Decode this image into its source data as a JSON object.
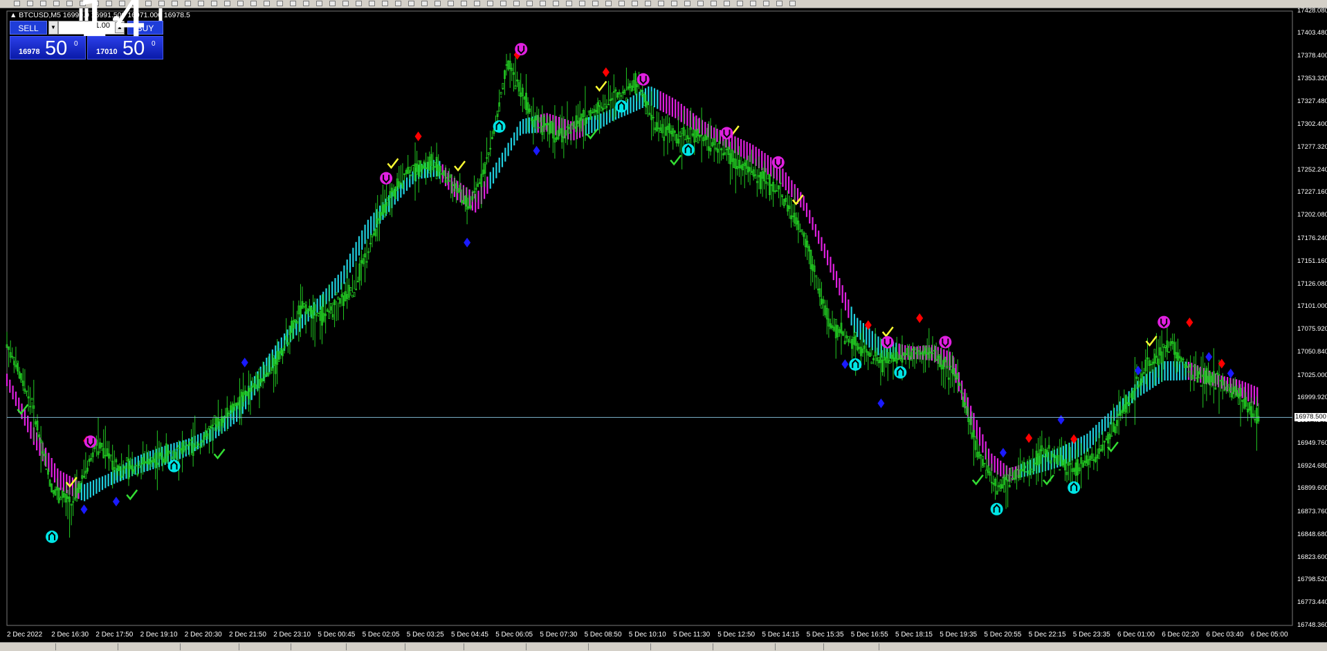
{
  "window": {
    "symbol_title": "▲ BTCUSD,M5  16990.0  16991.500  16971.000  16978.5",
    "overlay_digits": "14"
  },
  "trade_panel": {
    "sell_label": "SELL",
    "buy_label": "BUY",
    "lot_value": "1.00",
    "sell_price_small": "16978",
    "sell_price_big": "50",
    "sell_price_sup": "0",
    "buy_price_small": "17010",
    "buy_price_big": "50",
    "buy_price_sup": "0"
  },
  "current_price": "16978.500",
  "colors": {
    "candle": "#22cc22",
    "band_up": "#20d0e0",
    "band_down": "#e020e0",
    "buy_arrow": "#00e5e5",
    "sell_arrow": "#e020e0",
    "diamond_red": "#ff0000",
    "diamond_blue": "#1a1aff",
    "check_yellow": "#ffff33",
    "check_green": "#33dd33",
    "price_line": "#7fb7d0"
  },
  "chart_data": {
    "type": "candlestick",
    "symbol": "BTCUSD",
    "timeframe": "M5",
    "ylim": [
      16748.36,
      17428.08
    ],
    "y_ticks": [
      "17428.080",
      "17403.480",
      "17378.400",
      "17353.320",
      "17327.480",
      "17302.400",
      "17277.320",
      "17252.240",
      "17227.160",
      "17202.080",
      "17176.240",
      "17151.160",
      "17126.080",
      "17101.000",
      "17075.920",
      "17050.840",
      "17025.000",
      "16999.920",
      "16974.840",
      "16949.760",
      "16924.680",
      "16899.600",
      "16873.760",
      "16848.680",
      "16823.600",
      "16798.520",
      "16773.440",
      "16748.360"
    ],
    "x_ticks": [
      "2 Dec 2022",
      "2 Dec 16:30",
      "2 Dec 17:50",
      "2 Dec 19:10",
      "2 Dec 20:30",
      "2 Dec 21:50",
      "2 Dec 23:10",
      "5 Dec 00:45",
      "5 Dec 02:05",
      "5 Dec 03:25",
      "5 Dec 04:45",
      "5 Dec 06:05",
      "5 Dec 07:30",
      "5 Dec 08:50",
      "5 Dec 10:10",
      "5 Dec 11:30",
      "5 Dec 12:50",
      "5 Dec 14:15",
      "5 Dec 15:35",
      "5 Dec 16:55",
      "5 Dec 18:15",
      "5 Dec 19:35",
      "5 Dec 20:55",
      "5 Dec 22:15",
      "5 Dec 23:35",
      "6 Dec 01:00",
      "6 Dec 02:20",
      "6 Dec 03:40",
      "6 Dec 05:00"
    ],
    "price_path": [
      [
        0,
        17060
      ],
      [
        0.02,
        16990
      ],
      [
        0.035,
        16900
      ],
      [
        0.05,
        16880
      ],
      [
        0.07,
        16950
      ],
      [
        0.09,
        16920
      ],
      [
        0.11,
        16930
      ],
      [
        0.13,
        16940
      ],
      [
        0.15,
        16950
      ],
      [
        0.17,
        16980
      ],
      [
        0.19,
        17010
      ],
      [
        0.21,
        17040
      ],
      [
        0.23,
        17100
      ],
      [
        0.245,
        17090
      ],
      [
        0.27,
        17120
      ],
      [
        0.29,
        17200
      ],
      [
        0.31,
        17250
      ],
      [
        0.33,
        17260
      ],
      [
        0.345,
        17240
      ],
      [
        0.36,
        17210
      ],
      [
        0.375,
        17270
      ],
      [
        0.39,
        17370
      ],
      [
        0.41,
        17310
      ],
      [
        0.43,
        17290
      ],
      [
        0.45,
        17310
      ],
      [
        0.47,
        17330
      ],
      [
        0.49,
        17350
      ],
      [
        0.505,
        17300
      ],
      [
        0.52,
        17290
      ],
      [
        0.54,
        17290
      ],
      [
        0.56,
        17270
      ],
      [
        0.58,
        17250
      ],
      [
        0.6,
        17230
      ],
      [
        0.62,
        17180
      ],
      [
        0.64,
        17080
      ],
      [
        0.66,
        17060
      ],
      [
        0.68,
        17040
      ],
      [
        0.7,
        17050
      ],
      [
        0.72,
        17050
      ],
      [
        0.74,
        17020
      ],
      [
        0.755,
        16940
      ],
      [
        0.77,
        16900
      ],
      [
        0.79,
        16920
      ],
      [
        0.81,
        16940
      ],
      [
        0.83,
        16920
      ],
      [
        0.85,
        16940
      ],
      [
        0.87,
        16990
      ],
      [
        0.89,
        17040
      ],
      [
        0.905,
        17060
      ],
      [
        0.92,
        17030
      ],
      [
        0.94,
        17020
      ],
      [
        0.96,
        17000
      ],
      [
        0.97,
        16980
      ]
    ],
    "band_path": [
      [
        0,
        17020
      ],
      [
        0.02,
        16960
      ],
      [
        0.04,
        16910
      ],
      [
        0.06,
        16895
      ],
      [
        0.08,
        16910
      ],
      [
        0.1,
        16925
      ],
      [
        0.12,
        16935
      ],
      [
        0.14,
        16945
      ],
      [
        0.16,
        16960
      ],
      [
        0.18,
        16985
      ],
      [
        0.2,
        17030
      ],
      [
        0.22,
        17070
      ],
      [
        0.24,
        17100
      ],
      [
        0.26,
        17130
      ],
      [
        0.28,
        17185
      ],
      [
        0.3,
        17220
      ],
      [
        0.32,
        17250
      ],
      [
        0.335,
        17255
      ],
      [
        0.35,
        17230
      ],
      [
        0.365,
        17215
      ],
      [
        0.38,
        17250
      ],
      [
        0.4,
        17300
      ],
      [
        0.42,
        17305
      ],
      [
        0.44,
        17295
      ],
      [
        0.46,
        17305
      ],
      [
        0.48,
        17320
      ],
      [
        0.5,
        17335
      ],
      [
        0.52,
        17320
      ],
      [
        0.54,
        17300
      ],
      [
        0.56,
        17285
      ],
      [
        0.58,
        17270
      ],
      [
        0.6,
        17250
      ],
      [
        0.62,
        17215
      ],
      [
        0.64,
        17150
      ],
      [
        0.66,
        17080
      ],
      [
        0.68,
        17055
      ],
      [
        0.7,
        17050
      ],
      [
        0.72,
        17050
      ],
      [
        0.735,
        17040
      ],
      [
        0.75,
        16980
      ],
      [
        0.765,
        16930
      ],
      [
        0.78,
        16915
      ],
      [
        0.8,
        16925
      ],
      [
        0.82,
        16935
      ],
      [
        0.84,
        16950
      ],
      [
        0.86,
        16980
      ],
      [
        0.88,
        17010
      ],
      [
        0.9,
        17030
      ],
      [
        0.92,
        17030
      ],
      [
        0.94,
        17020
      ],
      [
        0.96,
        17010
      ],
      [
        0.975,
        17000
      ]
    ],
    "band_colors": [
      "down",
      "down",
      "down",
      "up",
      "up",
      "up",
      "up",
      "up",
      "up",
      "up",
      "up",
      "up",
      "up",
      "up",
      "up",
      "up",
      "up",
      "up",
      "down",
      "down",
      "up",
      "up",
      "down",
      "down",
      "up",
      "up",
      "up",
      "down",
      "down",
      "down",
      "down",
      "down",
      "down",
      "down",
      "down",
      "up",
      "up",
      "down",
      "down",
      "down",
      "down",
      "down",
      "up",
      "up",
      "up",
      "up",
      "up",
      "up",
      "up",
      "down",
      "down",
      "down"
    ]
  }
}
